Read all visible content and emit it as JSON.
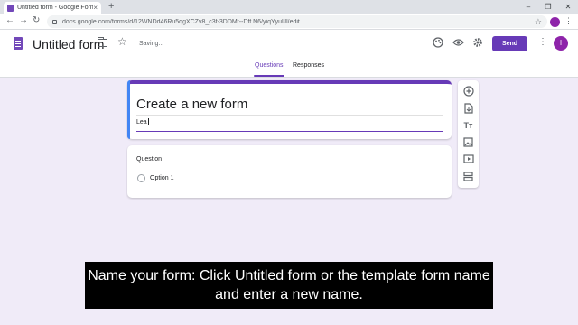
{
  "browser": {
    "tab_title": "Untitled form - Google Forms",
    "tab_close": "×",
    "new_tab": "+",
    "url": "docs.google.com/forms/d/12WNDd46Ru5qgXCZv8_c3f-3DDMt--Dff N6/yiqYyuUl/edit",
    "window_controls": [
      "–",
      "❐",
      "✕"
    ],
    "nav_back": "←",
    "nav_forward": "→",
    "nav_reload": "↻",
    "profile_initial": "l"
  },
  "header": {
    "doc_title": "Untitled form",
    "status": "Saving...",
    "send_label": "Send",
    "avatar_initial": "l"
  },
  "tabs": {
    "questions": "Questions",
    "responses": "Responses"
  },
  "form": {
    "title": "Create a new form",
    "description_value": "Lea"
  },
  "question": {
    "label": "Question",
    "option": "Option 1"
  },
  "toolbar": {
    "icons": [
      "add-question-icon",
      "import-questions-icon",
      "add-title-icon",
      "add-image-icon",
      "add-video-icon",
      "add-section-icon"
    ]
  },
  "caption": {
    "text": "Name your form: Click Untitled form or the template form name and enter a new name."
  },
  "colors": {
    "accent": "#673ab7",
    "background": "#f0ebf8",
    "focus_edge": "#4285f4"
  }
}
